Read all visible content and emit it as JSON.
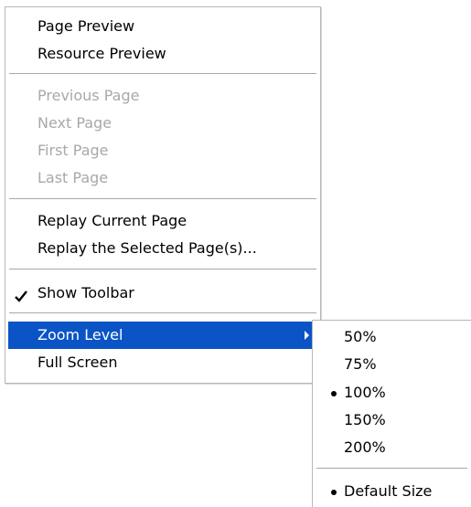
{
  "main_menu": {
    "items": [
      {
        "label": "Page Preview"
      },
      {
        "label": "Resource Preview"
      },
      {
        "label": "Previous Page",
        "disabled": true
      },
      {
        "label": "Next Page",
        "disabled": true
      },
      {
        "label": "First Page",
        "disabled": true
      },
      {
        "label": "Last Page",
        "disabled": true
      },
      {
        "label": "Replay Current Page"
      },
      {
        "label": "Replay the Selected Page(s)..."
      },
      {
        "label": "Show Toolbar",
        "checked": true
      },
      {
        "label": "Zoom Level",
        "highlighted": true,
        "has_submenu": true
      },
      {
        "label": "Full Screen"
      }
    ]
  },
  "zoom_submenu": {
    "items": [
      {
        "label": "50%"
      },
      {
        "label": "75%"
      },
      {
        "label": "100%",
        "selected": true
      },
      {
        "label": "150%"
      },
      {
        "label": "200%"
      },
      {
        "label": "Default Size",
        "selected": true
      }
    ]
  },
  "colors": {
    "highlight": "#0a54c6",
    "disabled_text": "#a8a8a8",
    "border": "#b7b7b7"
  },
  "icons": {
    "check": "check-icon",
    "submenu_arrow": "chevron-right-icon",
    "radio_bullet": "bullet-icon"
  }
}
